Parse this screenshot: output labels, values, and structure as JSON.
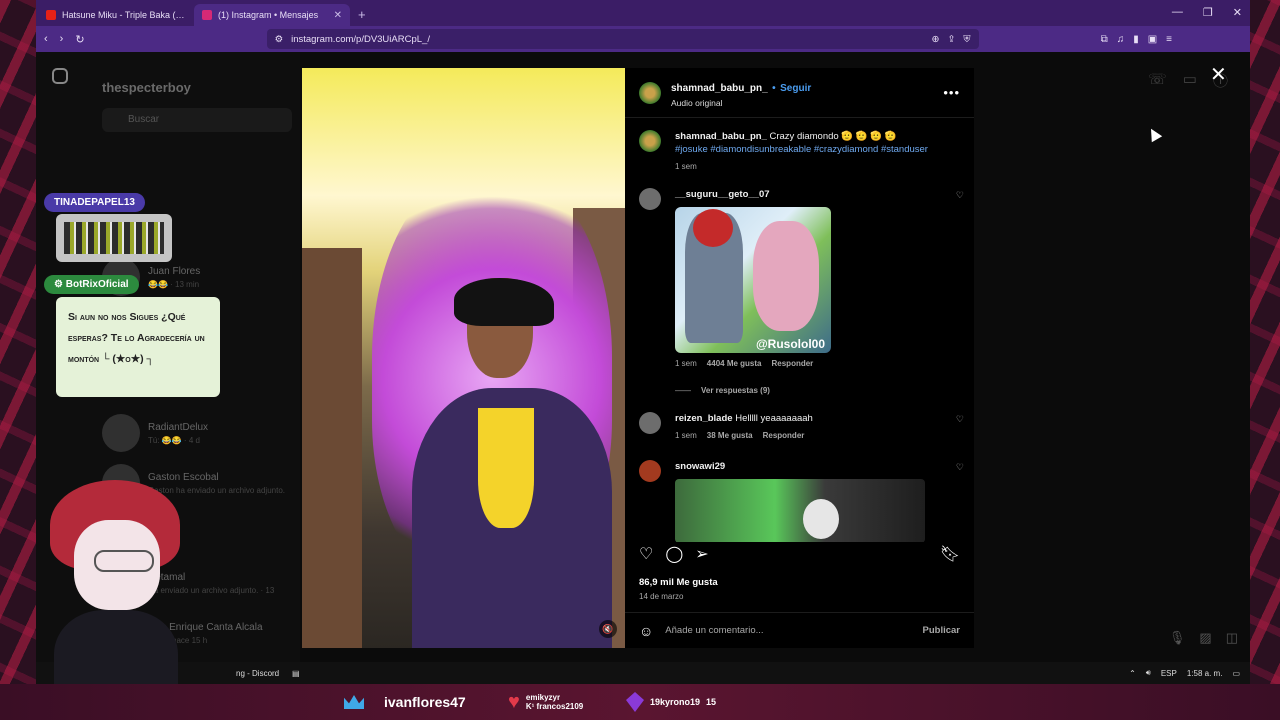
{
  "browser": {
    "tabs": [
      {
        "label": "Hatsune Miku - Triple Baka (4K UPSC",
        "fav_color": "#e62117",
        "active": false
      },
      {
        "label": "(1) Instagram • Mensajes",
        "fav_color": "#d62976",
        "active": true
      }
    ],
    "new_tab": "+",
    "url": "instagram.com/p/DV3UiARCpL_/"
  },
  "instagram": {
    "username": "thespecterboy",
    "search_placeholder": "Buscar",
    "chats": [
      {
        "name": "Juan Flores",
        "sub": "😂😂 · 13 min"
      },
      {
        "name": "RadiantDelux",
        "sub": "Tú: 😂😂 · 4 d"
      },
      {
        "name": "Gaston Escobal",
        "sub": "Gaston ha enviado un archivo adjunto."
      },
      {
        "name": "Retamal",
        "sub": "Ha enviado un archivo adjunto. · 13"
      },
      {
        "name": "Luis Enrique Canta Alcala",
        "sub": "Activo hace 15 h"
      }
    ],
    "post": {
      "author": "shamnad_babu_pn_",
      "follow": "Seguir",
      "separator": "•",
      "audio": "Audio original",
      "more": "•••",
      "caption_author": "shamnad_babu_pn_",
      "caption": "Crazy diamondo",
      "caption_emoji": "🫡 🫡 🫡 🫡",
      "hashtags": "#josuke #diamondisunbreakable #crazydiamond #standuser",
      "caption_time": "1 sem",
      "comments": [
        {
          "user": "__suguru__geto__07",
          "text": "",
          "time": "1 sem",
          "likes": "4404 Me gusta",
          "reply": "Responder",
          "image_tag": "@Rusolol00",
          "view_replies": "Ver respuestas (9)"
        },
        {
          "user": "reizen_blade",
          "text": "Helllll yeaaaaaaah",
          "time": "1 sem",
          "likes": "38 Me gusta",
          "reply": "Responder"
        },
        {
          "user": "snowawi29",
          "text": ""
        }
      ],
      "total_likes": "86,9 mil Me gusta",
      "date": "14 de marzo",
      "add_comment_placeholder": "Añade un comentario...",
      "publish": "Publicar"
    }
  },
  "overlay": {
    "badge_tina": "TINADEPAPEL13",
    "badge_botrix": "BotRixOficial",
    "bot_message": "Si aun no nos Sigues ¿Qué esperas? Te lo Agradecería un montón └ (★o★) ┐",
    "bottom": {
      "top_sub": "ivanflores47",
      "donator": "emikyzyr",
      "donator_sub": "K¹ francos2109",
      "gem_user": "19kyrono19",
      "gem_count": "15"
    }
  },
  "taskbar": {
    "discord": "ng - Discord",
    "lang": "ESP",
    "time": "1:58 a. m."
  }
}
